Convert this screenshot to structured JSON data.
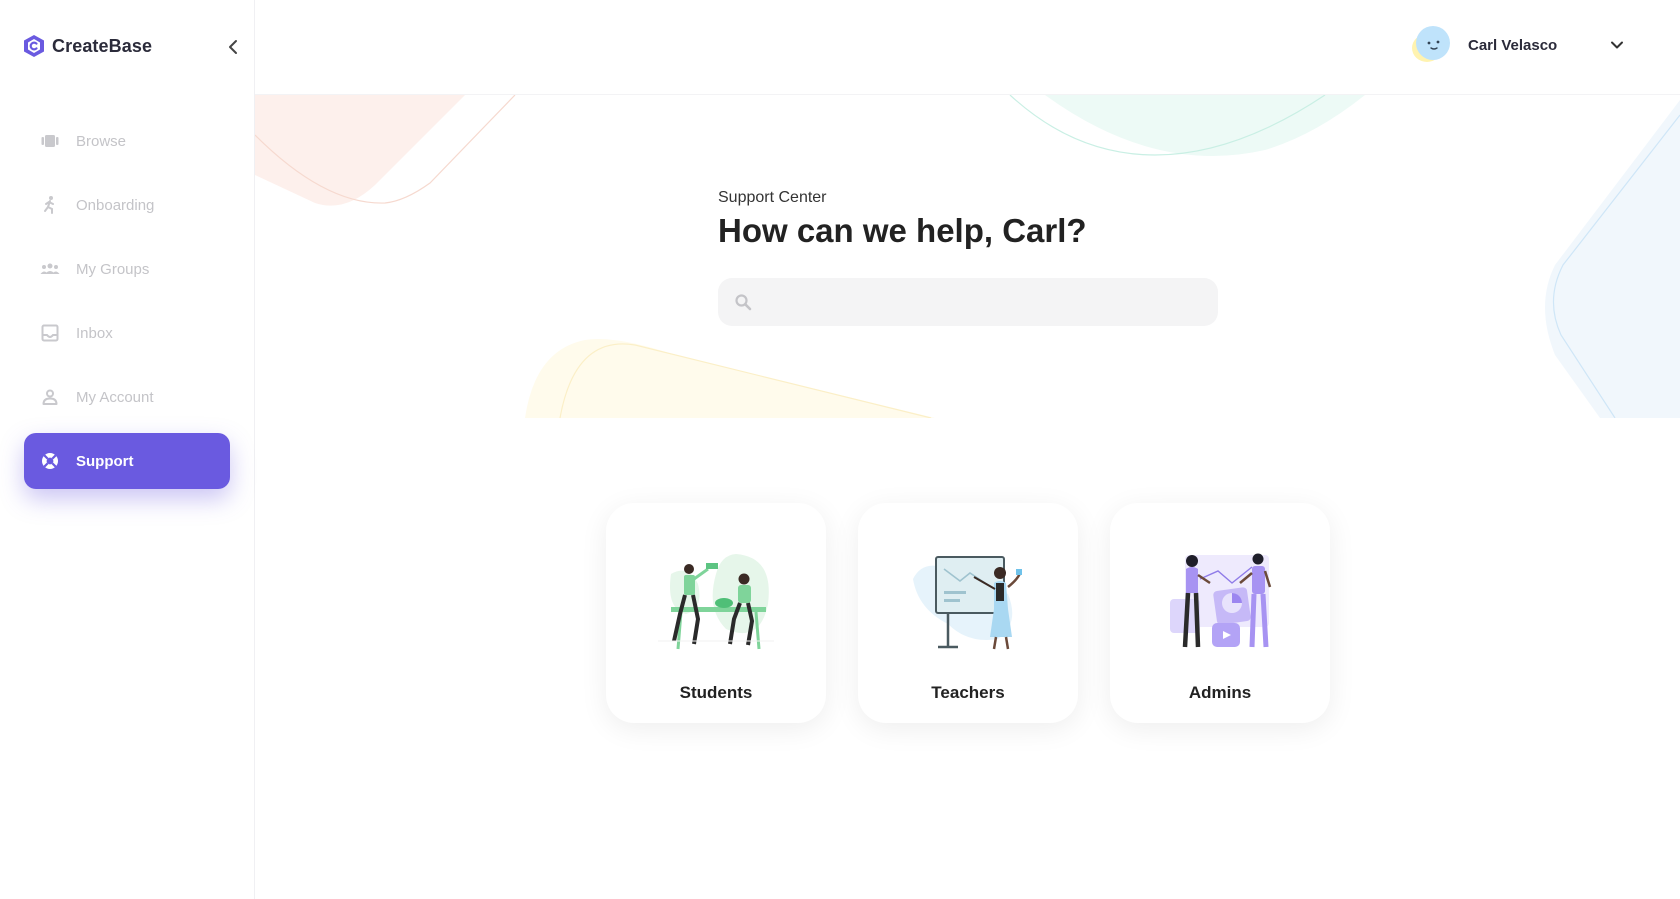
{
  "brand": {
    "name": "CreateBase",
    "accent": "#6a5ae0"
  },
  "sidebar": {
    "items": [
      {
        "label": "Browse",
        "icon": "browse-icon",
        "active": false
      },
      {
        "label": "Onboarding",
        "icon": "onboarding-icon",
        "active": false
      },
      {
        "label": "My Groups",
        "icon": "groups-icon",
        "active": false
      },
      {
        "label": "Inbox",
        "icon": "inbox-icon",
        "active": false
      },
      {
        "label": "My Account",
        "icon": "account-icon",
        "active": false
      },
      {
        "label": "Support",
        "icon": "lifebuoy-icon",
        "active": true
      }
    ]
  },
  "header": {
    "user_name": "Carl Velasco",
    "avatar": "avatar-icon"
  },
  "main": {
    "section_label": "Support Center",
    "headline": "How can we help, Carl?",
    "search": {
      "value": "",
      "placeholder": "",
      "icon": "search-icon"
    },
    "cards": [
      {
        "label": "Students",
        "icon": "students-illustration"
      },
      {
        "label": "Teachers",
        "icon": "teachers-illustration"
      },
      {
        "label": "Admins",
        "icon": "admins-illustration"
      }
    ]
  }
}
